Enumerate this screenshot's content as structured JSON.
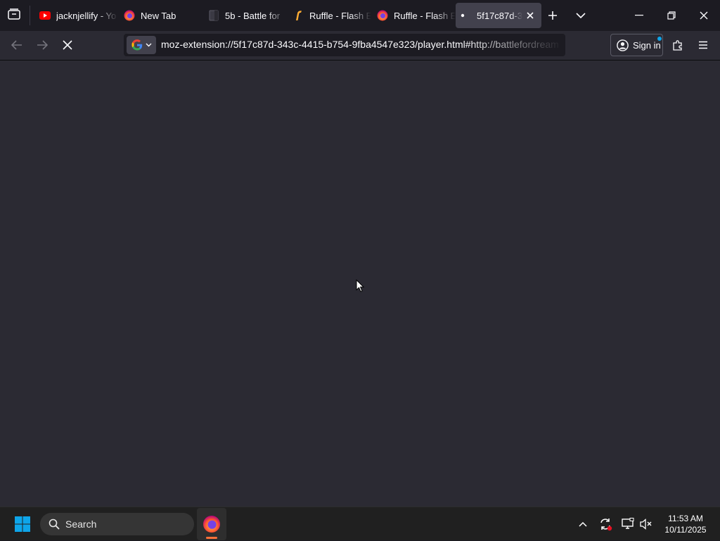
{
  "browser": {
    "tabs": [
      {
        "title": "jacknjellify - Yo",
        "icon": "youtube-icon",
        "active": false
      },
      {
        "title": "New Tab",
        "icon": "firefox-icon",
        "active": false
      },
      {
        "title": "5b - Battle for",
        "icon": "document-icon",
        "active": false
      },
      {
        "title": "Ruffle - Flash E",
        "icon": "ruffle-icon",
        "active": false
      },
      {
        "title": "Ruffle - Flash E",
        "icon": "firefox-icon",
        "active": false
      },
      {
        "title": "5f17c87d-3",
        "icon": "loading-dot-icon",
        "active": true
      }
    ],
    "url": "moz-extension://5f17c87d-343c-4415-b754-9fba4547e323/player.html#http://battlefordream",
    "search_engine_icon": "google-icon",
    "sign_in_label": "Sign in",
    "page_status": "loading"
  },
  "taskbar": {
    "search_label": "Search",
    "time": "11:53 AM",
    "date": "10/11/2025",
    "pinned_app_icon": "firefox-icon"
  },
  "colors": {
    "tabstrip": "#1c1b22",
    "toolbar": "#2b2a33",
    "active_tab": "#42414d",
    "content": "#2b2a33",
    "taskbar": "#202020",
    "windows_accent": "#0ea5e9",
    "youtube_red": "#ff0000"
  }
}
